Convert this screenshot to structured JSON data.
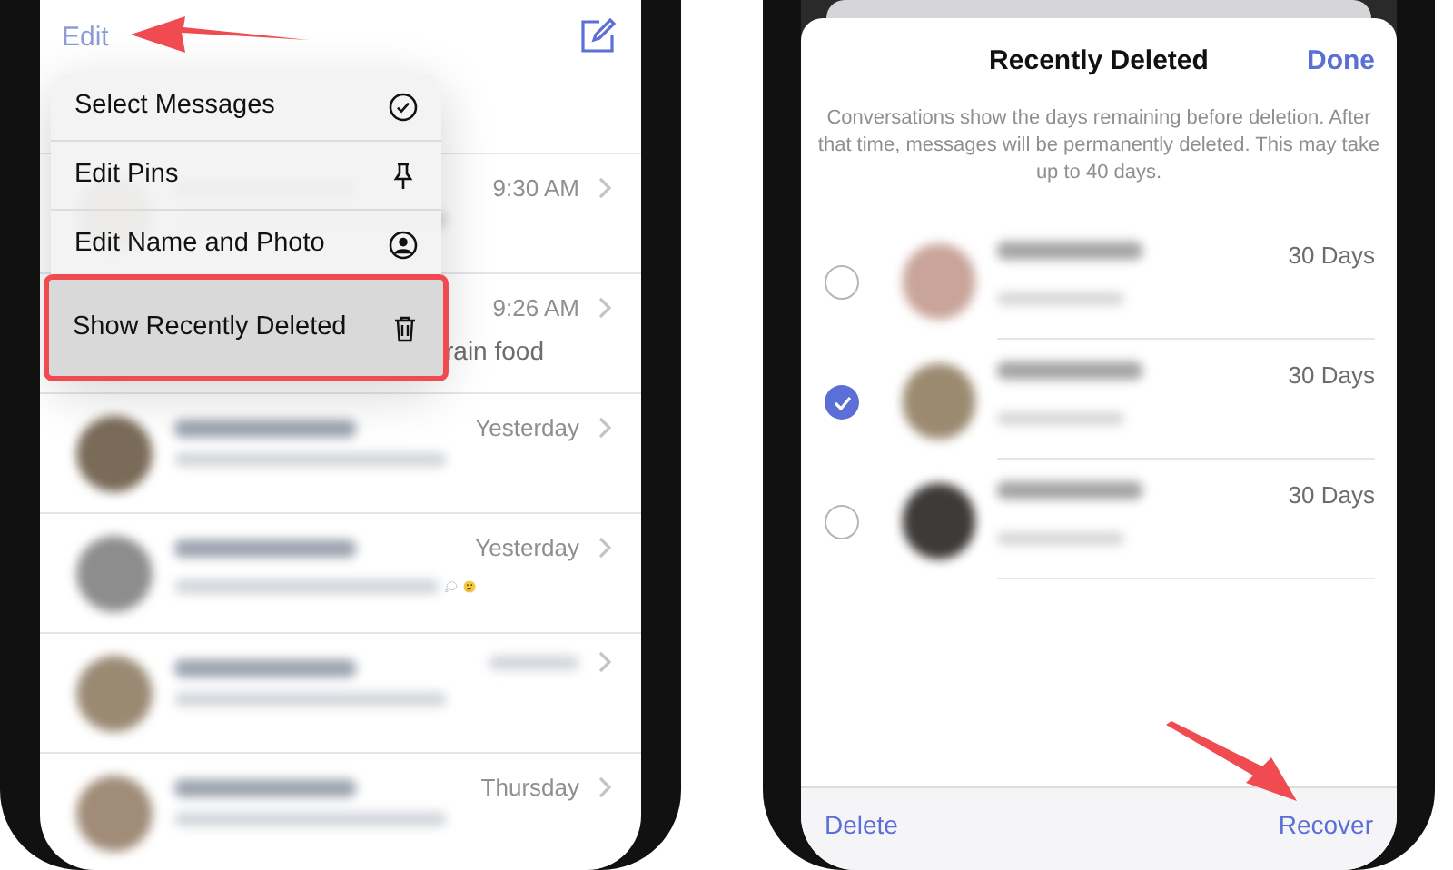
{
  "left_phone": {
    "header": {
      "edit": "Edit"
    },
    "conversations": [
      {
        "kind": "dated",
        "time": "9:30 AM"
      },
      {
        "kind": "dated",
        "time": "9:26 AM",
        "preview": "rain food"
      },
      {
        "kind": "dated",
        "time": "Yesterday"
      },
      {
        "kind": "dated",
        "time": "Yesterday"
      },
      {
        "kind": "blurred"
      },
      {
        "kind": "dated",
        "time": "Thursday"
      }
    ],
    "menu": {
      "items": [
        {
          "label": "Select Messages",
          "highlighted": false
        },
        {
          "label": "Edit Pins",
          "highlighted": false
        },
        {
          "label": "Edit Name and Photo",
          "highlighted": false
        },
        {
          "label": "Show Recently Deleted",
          "highlighted": true
        }
      ]
    }
  },
  "right_phone": {
    "sheet": {
      "title": "Recently Deleted",
      "done": "Done",
      "note": "Conversations show the days remaining before deletion. After that time, messages will be permanently deleted. This may take up to 40 days.",
      "items": [
        {
          "days": "30 Days",
          "selected": false
        },
        {
          "days": "30 Days",
          "selected": true
        },
        {
          "days": "30 Days",
          "selected": false
        }
      ],
      "toolbar": {
        "delete": "Delete",
        "recover": "Recover"
      }
    }
  }
}
